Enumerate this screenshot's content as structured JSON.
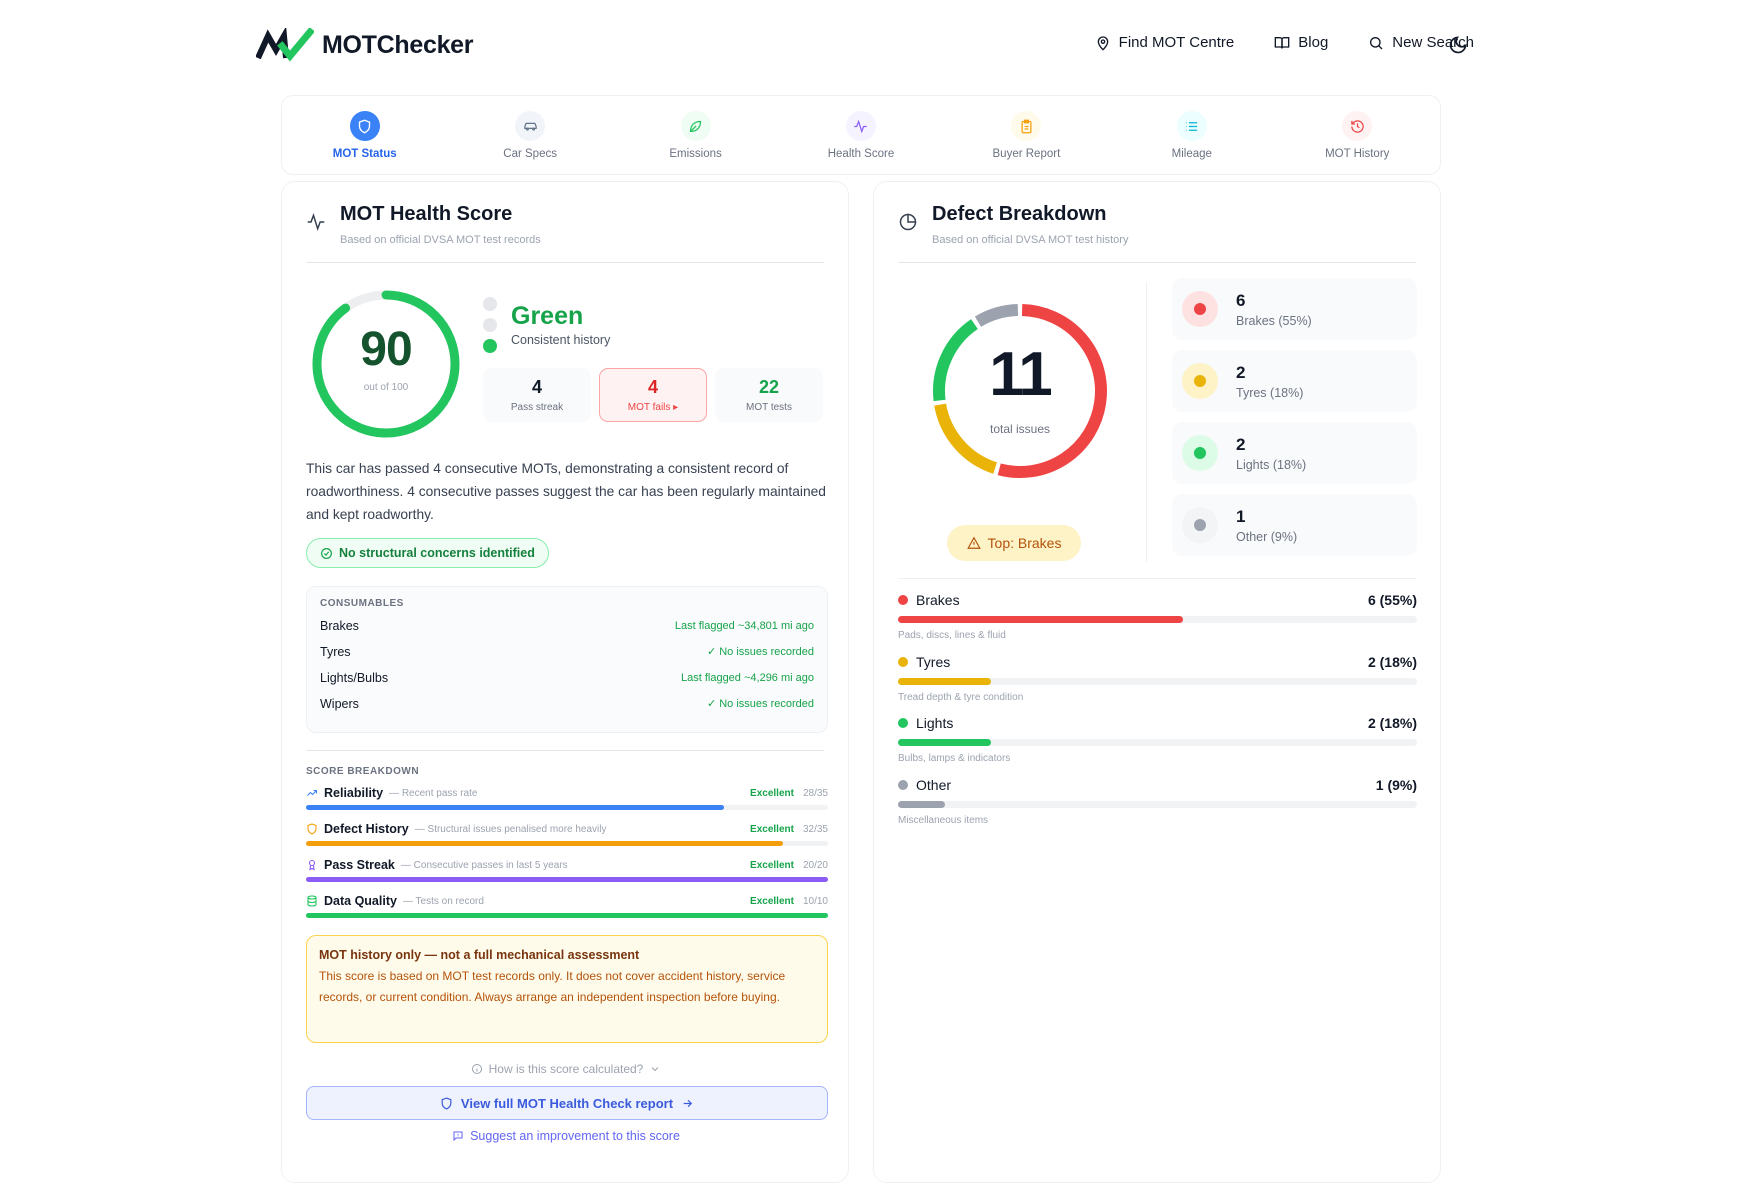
{
  "brand": {
    "name": "MOTChecker"
  },
  "nav": {
    "find_centre": "Find MOT Centre",
    "blog": "Blog",
    "new_search": "New Search"
  },
  "tabs": [
    {
      "label": "MOT Status",
      "icon": "shield-icon",
      "active": true,
      "color": "#3b82f6"
    },
    {
      "label": "Car Specs",
      "icon": "car-icon",
      "color": "#64748b"
    },
    {
      "label": "Emissions",
      "icon": "leaf-icon",
      "color": "#22c55e"
    },
    {
      "label": "Health Score",
      "icon": "activity-icon",
      "color": "#8b5cf6"
    },
    {
      "label": "Buyer Report",
      "icon": "clipboard-icon",
      "color": "#f59e0b"
    },
    {
      "label": "Mileage",
      "icon": "list-icon",
      "color": "#06b6d4"
    },
    {
      "label": "MOT History",
      "icon": "history-icon",
      "color": "#ef4444"
    }
  ],
  "health": {
    "title": "MOT Health Score",
    "subtitle": "Based on official DVSA MOT test records",
    "score": "90",
    "score_value": 90,
    "score_max_label": "out of 100",
    "rating": "Green",
    "rating_desc": "Consistent history",
    "stats": {
      "pass_streak": {
        "value": "4",
        "label": "Pass streak"
      },
      "mot_fails": {
        "value": "4",
        "label": "MOT fails ▸"
      },
      "mot_tests": {
        "value": "22",
        "label": "MOT tests"
      }
    },
    "summary": "This car has passed 4 consecutive MOTs, demonstrating a consistent record of roadworthiness. 4 consecutive passes suggest the car has been regularly maintained and kept roadworthy.",
    "structural": "No structural concerns identified",
    "consumables": {
      "label": "CONSUMABLES",
      "items": [
        {
          "name": "Brakes",
          "value": "Last flagged ~34,801 mi ago"
        },
        {
          "name": "Tyres",
          "value": "✓ No issues recorded"
        },
        {
          "name": "Lights/Bulbs",
          "value": "Last flagged ~4,296 mi ago"
        },
        {
          "name": "Wipers",
          "value": "✓ No issues recorded"
        }
      ]
    },
    "breakdown": {
      "label": "SCORE BREAKDOWN",
      "items": [
        {
          "name": "Reliability",
          "desc": "— Recent pass rate",
          "grade": "Excellent",
          "score": "28/35",
          "fraction": 0.8,
          "color": "#3b82f6",
          "icon": "trend-up-icon"
        },
        {
          "name": "Defect History",
          "desc": "— Structural issues penalised more heavily",
          "grade": "Excellent",
          "score": "32/35",
          "fraction": 0.914,
          "color": "#f59e0b",
          "icon": "shield-icon"
        },
        {
          "name": "Pass Streak",
          "desc": "— Consecutive passes in last 5 years",
          "grade": "Excellent",
          "score": "20/20",
          "fraction": 1.0,
          "color": "#8b5cf6",
          "icon": "award-icon"
        },
        {
          "name": "Data Quality",
          "desc": "— Tests on record",
          "grade": "Excellent",
          "score": "10/10",
          "fraction": 1.0,
          "color": "#22c55e",
          "icon": "database-icon"
        }
      ]
    },
    "disclaimer": {
      "title": "MOT history only — not a full mechanical assessment",
      "body": "This score is based on MOT test records only. It does not cover accident history, service records, or current condition. Always arrange an independent inspection before buying."
    },
    "how_calculated": "How is this score calculated?",
    "view_report": "View full MOT Health Check report",
    "suggest": "Suggest an improvement to this score"
  },
  "defects": {
    "title": "Defect Breakdown",
    "subtitle": "Based on official DVSA MOT test history",
    "total": "11",
    "total_label": "total issues",
    "top_label": "Top: Brakes",
    "categories": [
      {
        "name": "Brakes",
        "count": "6",
        "legend": "Brakes (55%)",
        "value_label": "6 (55%)",
        "desc": "Pads, discs, lines & fluid",
        "count_value": 6,
        "percent": 55,
        "color": "#ef4444",
        "bg": "#fee2e2"
      },
      {
        "name": "Tyres",
        "count": "2",
        "legend": "Tyres (18%)",
        "value_label": "2 (18%)",
        "desc": "Tread depth & tyre condition",
        "count_value": 2,
        "percent": 18,
        "color": "#eab308",
        "bg": "#fef3c7"
      },
      {
        "name": "Lights",
        "count": "2",
        "legend": "Lights (18%)",
        "value_label": "2 (18%)",
        "desc": "Bulbs, lamps & indicators",
        "count_value": 2,
        "percent": 18,
        "color": "#22c55e",
        "bg": "#dcfce7"
      },
      {
        "name": "Other",
        "count": "1",
        "legend": "Other (9%)",
        "value_label": "1 (9%)",
        "desc": "Miscellaneous items",
        "count_value": 1,
        "percent": 9,
        "color": "#9ca3af",
        "bg": "#f3f4f6"
      }
    ]
  }
}
